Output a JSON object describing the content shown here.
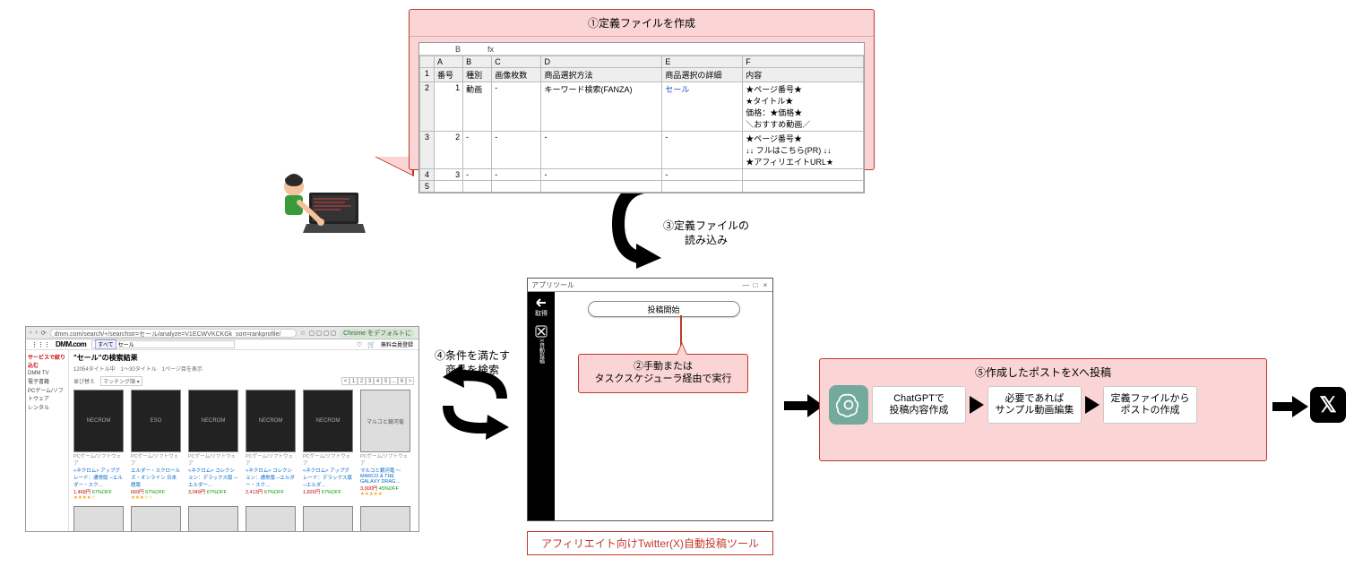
{
  "step1": {
    "title": "①定義ファイルを作成",
    "toolbar": {
      "bold": "B",
      "fx": "fx"
    },
    "columns": [
      "",
      "番号",
      "種別",
      "画像枚数",
      "商品選択方法",
      "商品選択の詳細",
      "内容"
    ],
    "col_letters": [
      "",
      "A",
      "B",
      "C",
      "D",
      "E",
      "F"
    ],
    "rows": [
      {
        "rh": "2",
        "num": "1",
        "type": "動画",
        "imgs": "-",
        "method": "キーワード検索(FANZA)",
        "detail": "セール",
        "content": "★ページ番号★\n★タイトル★\n価格：★価格★\n＼おすすめ動画／"
      },
      {
        "rh": "3",
        "num": "2",
        "type": "-",
        "imgs": "-",
        "method": "-",
        "detail": "-",
        "content": "★ページ番号★\n↓↓ フルはこちら(PR) ↓↓\n★アフィリエイトURL★"
      },
      {
        "rh": "4",
        "num": "3",
        "type": "-",
        "imgs": "-",
        "method": "-",
        "detail": "-",
        "content": ""
      }
    ]
  },
  "step2": {
    "line1": "②手動または",
    "line2": "タスクスケジューラ経由で実行"
  },
  "step3": {
    "line1": "③定義ファイルの",
    "line2": "読み込み"
  },
  "step4": {
    "line1": "④条件を満たす",
    "line2": "商品を検索"
  },
  "step5": {
    "title": "⑤作成したポストをXへ投稿",
    "sub1": {
      "l1": "ChatGPTで",
      "l2": "投稿内容作成"
    },
    "sub2": {
      "l1": "必要であれば",
      "l2": "サンプル動画編集"
    },
    "sub3": {
      "l1": "定義ファイルから",
      "l2": "ポストの作成"
    }
  },
  "tool": {
    "window_title": "アプリツール",
    "window_buttons": {
      "min": "—",
      "max": "□",
      "close": "×"
    },
    "side": {
      "back": "取得",
      "auto_post": "X自動投稿"
    },
    "start_button": "投稿開始",
    "caption": "アフィリエイト向けTwitter(X)自動投稿ツール"
  },
  "browser": {
    "url": "dmm.com/search/+/searchstr=セール/analyze=V1ECWVKCKGk_sort=rankprofile/",
    "chrome_badge": "Chrome をデフォルトに",
    "logo": "DMM.com",
    "search_tag": "すべて",
    "search_value": "セール",
    "right_link": "無料会員登録",
    "sidebar": {
      "header": "サービスで絞り込む",
      "items": [
        "DMM TV",
        "電子書籍",
        "PCゲーム/ソフトウェア",
        "レンタル"
      ]
    },
    "results_header": "\"セール\"の検索結果",
    "results_sub": "12054タイトル中　1～30タイトル　1ページ目を表示",
    "sort_label": "並び替え",
    "sort_value": "マッチング順",
    "pager": [
      "<",
      "1",
      "2",
      "3",
      "4",
      "5",
      "...",
      "6",
      ">"
    ],
    "products": [
      {
        "cat": "PCゲーム/ソフトウェア",
        "name": "<ネクロム> アップグレード：通常版 ─エルダー・スク…",
        "price": "1,468円",
        "off": "67%OFF",
        "stars": "★★★★☆",
        "thumb": "NECROM"
      },
      {
        "cat": "PCゲーム/ソフトウェア",
        "name": "エルダー・スクロールズ・オンライン 日本語版",
        "price": "660円",
        "off": "67%OFF",
        "stars": "★★★☆☆",
        "thumb": "ESO"
      },
      {
        "cat": "PCゲーム/ソフトウェア",
        "name": "<ネクロム> コレクション：デラックス版 ─エルダー…",
        "price": "3,049円",
        "off": "67%OFF",
        "stars": "",
        "thumb": "NECROM"
      },
      {
        "cat": "PCゲーム/ソフトウェア",
        "name": "<ネクロム> コレクション：通常版 ─エルダー・スク…",
        "price": "2,413円",
        "off": "67%OFF",
        "stars": "",
        "thumb": "NECROM"
      },
      {
        "cat": "PCゲーム/ソフトウェア",
        "name": "<ネクロム> アップグレード：デラックス版 ─エルダ…",
        "price": "1,826円",
        "off": "67%OFF",
        "stars": "",
        "thumb": "NECROM"
      },
      {
        "cat": "PCゲーム/ソフトウェア",
        "name": "マルコと銀河竜 ～MARCO & THE GALAXY DRAG…",
        "price": "3,000円",
        "off": "45%OFF",
        "stars": "★★★★★",
        "thumb": "マルコと銀河竜",
        "light": true
      }
    ]
  },
  "x_logo": "𝕏"
}
